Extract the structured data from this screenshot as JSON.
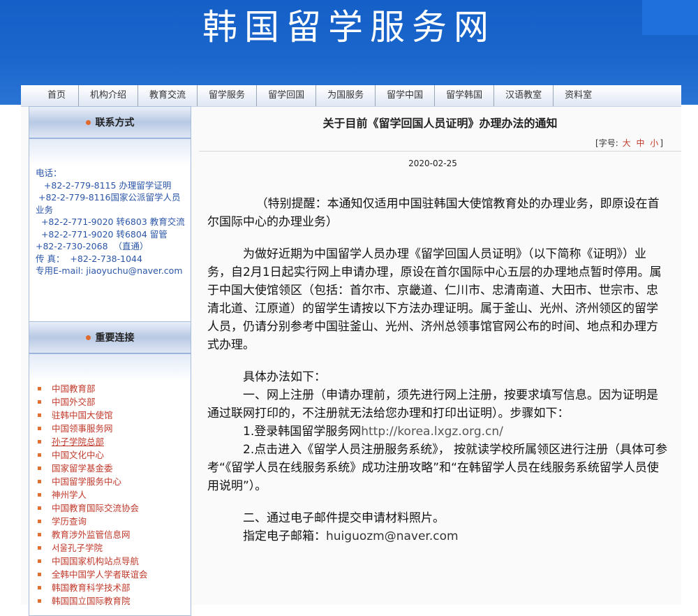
{
  "site_title": "韩国留学服务网",
  "nav": [
    "首页",
    "机构介绍",
    "教育交流",
    "留学服务",
    "留学回国",
    "为国服务",
    "留学中国",
    "留学韩国",
    "汉语教室",
    "资料室"
  ],
  "contact": {
    "heading": "联系方式",
    "lines": [
      "电话：",
      "   +82-2-779-8115 办理留学证明",
      " +82-2-779-8116国家公派留学人员",
      "业务",
      "  +82-2-771-9020 转6803 教育交流",
      "  +82-2-771-9020 转6804 留管",
      "+82-2-730-2068  （直通）",
      "传 真：  +82-2-738-1044",
      "专用E-mail: jiaoyuchu@naver.com"
    ]
  },
  "links": {
    "heading": "重要连接",
    "items": [
      "中国教育部",
      "中国外交部",
      "驻韩中国大使馆",
      "中国领事服务网",
      "孙子学院总部",
      "中国文化中心",
      "国家留学基金委",
      "中国留学服务中心",
      "神州学人",
      "中国教育国际交流协会",
      "学历查询",
      "教育涉外监管信息网",
      "서울孔子学院",
      "中国国家机构站点导航",
      "全韩中国学人学者联谊会",
      "韩国教育科学技术部",
      "韩国国立国际教育院"
    ]
  },
  "article": {
    "title": "关于目前《留学回国人员证明》办理办法的通知",
    "font_size_label": "[字号:",
    "font_sizes": [
      "大",
      "中",
      "小"
    ],
    "font_size_close": "]",
    "date": "2020-02-25",
    "p1": "（特别提醒：本通知仅适用中国驻韩国大使馆教育处的办理业务，即原设在首尔国际中心的办理业务）",
    "p2": "为做好近期为中国留学人员办理《留学回国人员证明》（以下简称《证明》）业务，自2月1日起实行网上申请办理，原设在首尔国际中心五层的办理地点暂时停用。属于中国大使馆领区（包括：首尔市、京畿道、仁川市、忠清南道、大田市、世宗市、忠清北道、江原道）的留学生请按以下方法办理证明。属于釜山、光州、济州领区的留学人员，仍请分别参考中国驻釜山、光州、济州总领事馆官网公布的时间、地点和办理方式办理。",
    "p3": "具体办法如下：",
    "p4": "一、网上注册（申请办理前，须先进行网上注册，按要求填写信息。因为证明是通过联网打印的，不注册就无法给您办理和打印出证明）。步骤如下：",
    "p5_prefix": "1.登录韩国留学服务网",
    "p5_url": "http://korea.lxgz.org.cn/",
    "p6": "2.点击进入《留学人员注册服务系统》， 按就读学校所属领区进行注册（具体可参考“《留学人员在线服务系统》成功注册攻略”和“在韩留学人员在线服务系统留学人员使用说明”）。",
    "p7": "二、通过电子邮件提交申请材料照片。",
    "p8_prefix": "指定电子邮箱：",
    "p8_email": "huiguozm@naver.com"
  }
}
